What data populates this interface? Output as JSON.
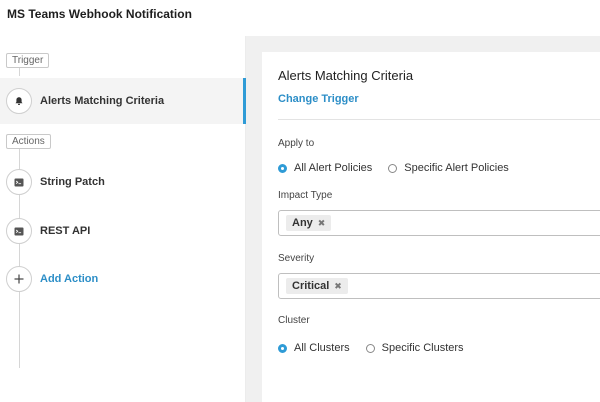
{
  "header": {
    "title": "MS Teams Webhook Notification"
  },
  "sidebar": {
    "trigger_tag": "Trigger",
    "actions_tag": "Actions",
    "trigger_item": {
      "label": "Alerts Matching Criteria",
      "icon": "bell-icon"
    },
    "actions": [
      {
        "label": "String Patch",
        "icon": "terminal-icon"
      },
      {
        "label": "REST API",
        "icon": "terminal-icon"
      }
    ],
    "add_action": {
      "label": "Add Action",
      "icon": "plus-icon"
    }
  },
  "panel": {
    "title": "Alerts Matching Criteria",
    "change_trigger": "Change Trigger",
    "apply_to": {
      "label": "Apply to",
      "options": [
        "All Alert Policies",
        "Specific Alert Policies"
      ],
      "selected": "All Alert Policies"
    },
    "impact_type": {
      "label": "Impact Type",
      "tags": [
        "Any"
      ]
    },
    "severity": {
      "label": "Severity",
      "tags": [
        "Critical"
      ]
    },
    "cluster": {
      "label": "Cluster",
      "options": [
        "All Clusters",
        "Specific Clusters"
      ],
      "selected": "All Clusters"
    }
  },
  "colors": {
    "accent": "#2f9bd6",
    "link": "#2c8ec7",
    "content_bg": "#f0f0f0"
  }
}
